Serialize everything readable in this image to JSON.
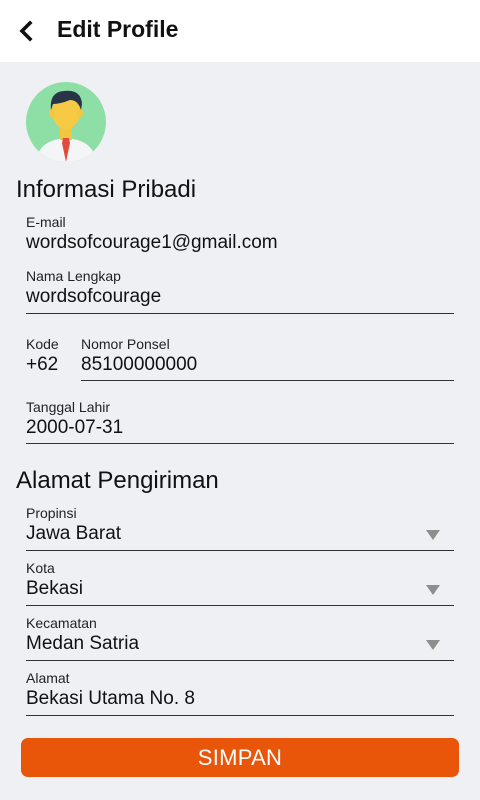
{
  "header": {
    "title": "Edit Profile",
    "back_icon": "back-arrow-icon"
  },
  "avatar_icon": "user-avatar-icon",
  "personal": {
    "heading": "Informasi Pribadi",
    "email": {
      "label": "E-mail",
      "value": "wordsofcourage1@gmail.com"
    },
    "full_name": {
      "label": "Nama Lengkap",
      "value": "wordsofcourage"
    },
    "code": {
      "label": "Kode",
      "value": "+62"
    },
    "phone": {
      "label": "Nomor Ponsel",
      "value": "85100000000"
    },
    "birth_date": {
      "label": "Tanggal Lahir",
      "value": "2000-07-31"
    }
  },
  "shipping": {
    "heading": "Alamat Pengiriman",
    "province": {
      "label": "Propinsi",
      "value": "Jawa Barat"
    },
    "city": {
      "label": "Kota",
      "value": "Bekasi"
    },
    "district": {
      "label": "Kecamatan",
      "value": "Medan Satria"
    },
    "address": {
      "label": "Alamat",
      "value": "Bekasi Utama No. 8"
    }
  },
  "save_button": {
    "label": "SIMPAN"
  },
  "colors": {
    "accent": "#e9560a",
    "background": "#eff0f4",
    "header": "#ffffff"
  }
}
